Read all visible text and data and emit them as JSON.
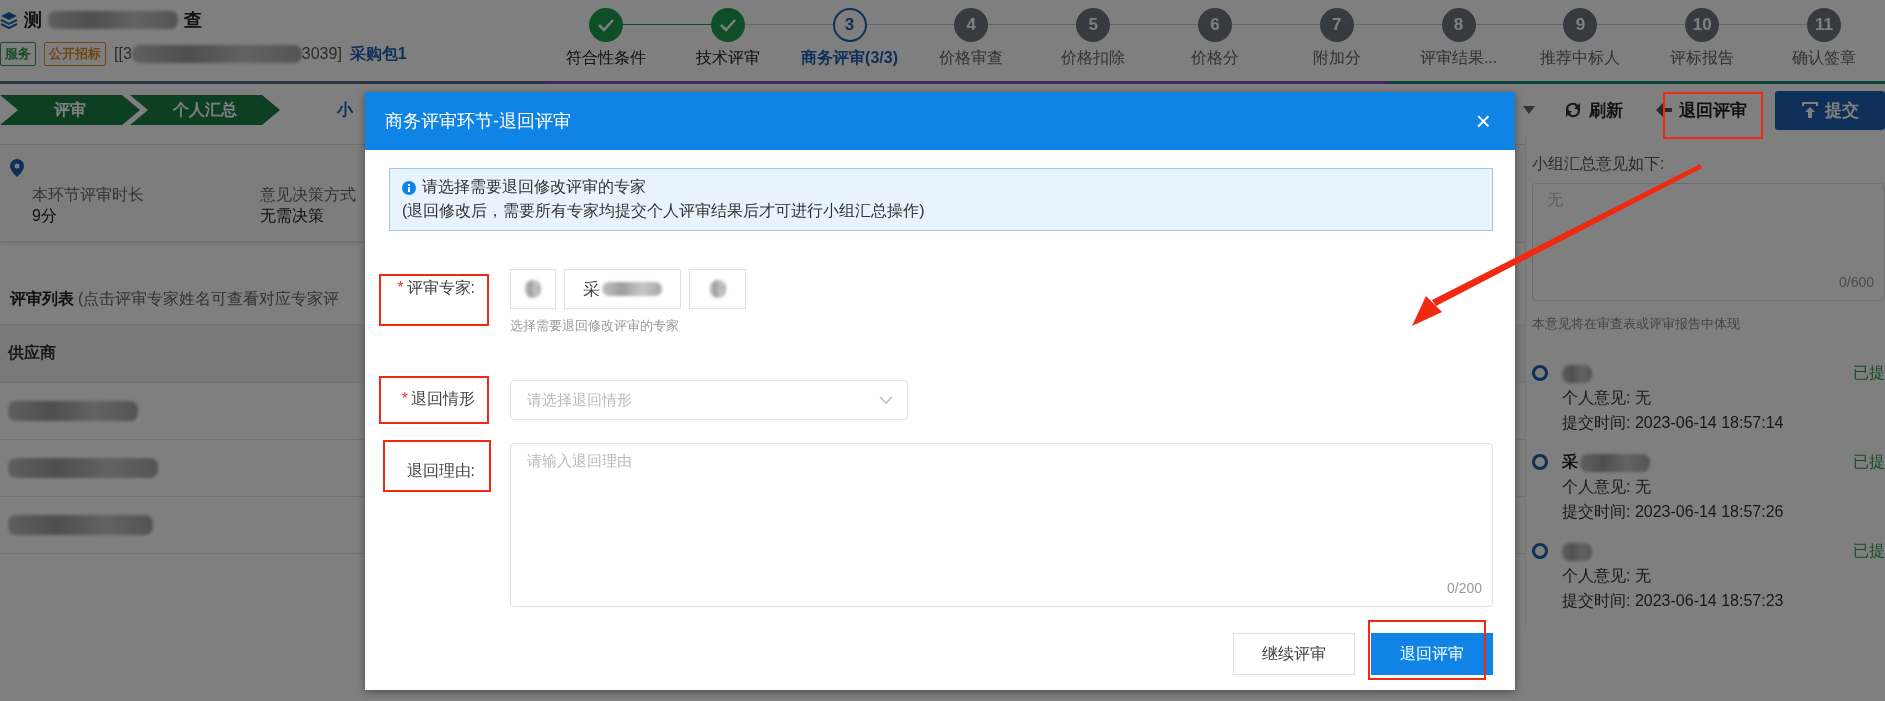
{
  "project": {
    "title_start": "测",
    "title_end": "查",
    "tags": [
      {
        "label": "服务",
        "kind": "category"
      },
      {
        "label": "公开招标",
        "kind": "method"
      }
    ],
    "code_start": "[[3",
    "code_end": "3039]",
    "package": "采购包1"
  },
  "steps": [
    {
      "label": "符合性条件",
      "completed": true,
      "selected": false
    },
    {
      "label": "技术评审",
      "completed": true,
      "selected": false
    },
    {
      "label": "商务评审(3/3)",
      "number": "3",
      "completed": false,
      "selected": true
    },
    {
      "label": "价格审查",
      "number": "4",
      "completed": false,
      "selected": false
    },
    {
      "label": "价格扣除",
      "number": "5",
      "completed": false,
      "selected": false
    },
    {
      "label": "价格分",
      "number": "6",
      "completed": false,
      "selected": false
    },
    {
      "label": "附加分",
      "number": "7",
      "completed": false,
      "selected": false
    },
    {
      "label": "评审结果...",
      "number": "8",
      "completed": false,
      "selected": false
    },
    {
      "label": "推荐中标人",
      "number": "9",
      "completed": false,
      "selected": false
    },
    {
      "label": "评标报告",
      "number": "10",
      "completed": false,
      "selected": false
    },
    {
      "label": "确认签章",
      "number": "11",
      "completed": false,
      "selected": false
    }
  ],
  "flow": [
    {
      "label": "评审",
      "completed": true
    },
    {
      "label": "个人汇总",
      "completed": true
    },
    {
      "label": "小",
      "completed": false
    }
  ],
  "toolbar": [
    {
      "label": "刷新",
      "kind": "refresh"
    },
    {
      "label": "退回评审",
      "kind": "return"
    },
    {
      "label": "提交",
      "kind": "submit"
    }
  ],
  "info": [
    {
      "label": "本环节评审时长",
      "value": "9分"
    },
    {
      "label": "意见决策方式",
      "value": "无需决策"
    }
  ],
  "review_list": {
    "title": "评审列表",
    "hint": "(点击评审专家姓名可查看对应专家评",
    "columns": [
      "供应商"
    ]
  },
  "summary": {
    "label": "小组汇总意见如下:",
    "placeholder": "无",
    "counter": "0/600",
    "note": "本意见将在审查表或评审报告中体现"
  },
  "experts": [
    {
      "status": "已提",
      "opinion_label": "个人意见:",
      "opinion": "无",
      "time_label": "提交时间:",
      "time": "2023-06-14 18:57:14"
    },
    {
      "name": "采",
      "status": "已提",
      "opinion_label": "个人意见:",
      "opinion": "无",
      "time_label": "提交时间:",
      "time": "2023-06-14 18:57:26"
    },
    {
      "status": "已提",
      "opinion_label": "个人意见:",
      "opinion": "无",
      "time_label": "提交时间:",
      "time": "2023-06-14 18:57:23"
    }
  ],
  "dialog": {
    "title": "商务评审环节-退回评审",
    "close": "×",
    "alert_title": "请选择需要退回修改评审的专家",
    "alert_text": "(退回修改后，需要所有专家均提交个人评审结果后才可进行小组汇总操作)",
    "fields": [
      {
        "kind": "chips",
        "label": "评审专家:",
        "required_mark": "*",
        "chips": [
          {
            "kind": "redacted"
          },
          {
            "kind": "partial",
            "text": "采"
          },
          {
            "kind": "redacted"
          }
        ],
        "hint": "选择需要退回修改评审的专家"
      },
      {
        "kind": "select",
        "label": "退回情形",
        "required_mark": "*",
        "placeholder": "请选择退回情形"
      },
      {
        "kind": "textarea",
        "label": "退回理由:",
        "placeholder": "请输入退回理由",
        "counter": "0/200"
      }
    ],
    "buttons": [
      {
        "label": "继续评审",
        "kind": "secondary"
      },
      {
        "label": "退回评审",
        "kind": "primary"
      }
    ]
  }
}
